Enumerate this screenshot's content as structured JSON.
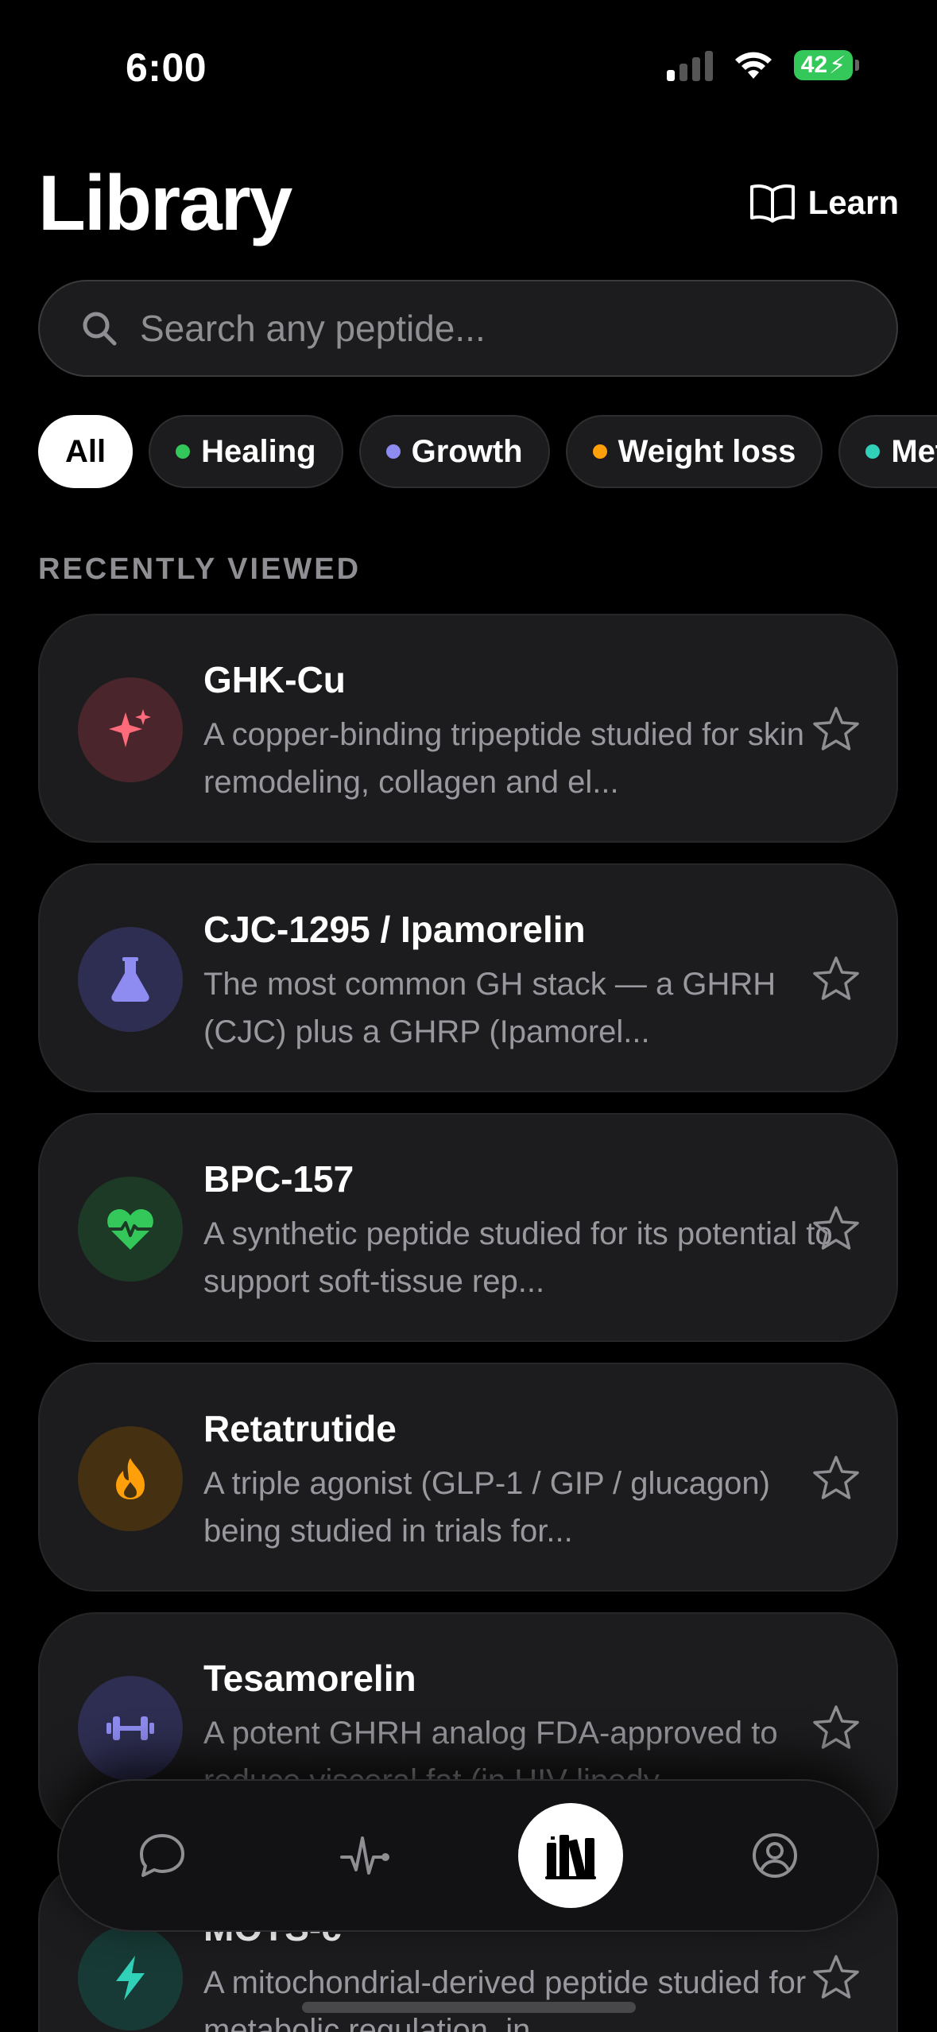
{
  "status": {
    "time": "6:00",
    "battery": "42"
  },
  "header": {
    "title": "Library",
    "learn_label": "Learn"
  },
  "search": {
    "placeholder": "Search any peptide..."
  },
  "chips": [
    {
      "label": "All",
      "dot": null
    },
    {
      "label": "Healing",
      "dot": "#34c759"
    },
    {
      "label": "Growth",
      "dot": "#8e8cf0"
    },
    {
      "label": "Weight loss",
      "dot": "#ff9f0a"
    },
    {
      "label": "Meta",
      "dot": "#30d1b8"
    }
  ],
  "section": {
    "recently_viewed": "RECENTLY VIEWED"
  },
  "cards": [
    {
      "name": "GHK-Cu",
      "desc": "A copper-binding tripeptide studied for skin remodeling, collagen and el...",
      "icon": "sparkle-icon",
      "color": "#ff6b7a",
      "bg": "#4a262c"
    },
    {
      "name": "CJC-1295 / Ipamorelin",
      "desc": "The most common GH stack — a GHRH (CJC) plus a GHRP (Ipamorel...",
      "icon": "flask-icon",
      "color": "#8e8cf0",
      "bg": "#2e2e52"
    },
    {
      "name": "BPC-157",
      "desc": "A synthetic peptide studied for its potential to support soft-tissue rep...",
      "icon": "heart-pulse-icon",
      "color": "#34c759",
      "bg": "#1c3a26"
    },
    {
      "name": "Retatrutide",
      "desc": "A triple agonist (GLP-1 / GIP / glucagon) being studied in trials for...",
      "icon": "flame-icon",
      "color": "#ff9f0a",
      "bg": "#453012"
    },
    {
      "name": "Tesamorelin",
      "desc": "A potent GHRH analog FDA-approved to reduce visceral fat (in HIV lipody...",
      "icon": "dumbbell-icon",
      "color": "#8e8cf0",
      "bg": "#2e2e52"
    },
    {
      "name": "MOTS-c",
      "desc": "A mitochondrial-derived peptide studied for metabolic regulation, in...",
      "icon": "bolt-icon",
      "color": "#30d1b8",
      "bg": "#173a36"
    }
  ],
  "nav": [
    {
      "name": "chat",
      "icon": "chat-icon",
      "active": false
    },
    {
      "name": "activity",
      "icon": "activity-icon",
      "active": false
    },
    {
      "name": "library",
      "icon": "library-icon",
      "active": true
    },
    {
      "name": "profile",
      "icon": "profile-icon",
      "active": false
    }
  ],
  "colors": {
    "background": "#000000",
    "card": "#1c1c1e",
    "muted": "#8e8e93"
  }
}
